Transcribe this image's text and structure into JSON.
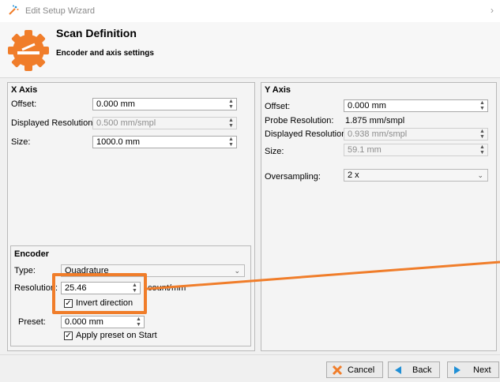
{
  "window": {
    "title": "Edit Setup Wizard"
  },
  "header": {
    "title": "Scan Definition",
    "subtitle": "Encoder and axis settings"
  },
  "x_axis": {
    "title": "X Axis",
    "offset_label": "Offset:",
    "offset_value": "0.000 mm",
    "res_label": "Displayed Resolution:",
    "res_value": "0.500 mm/smpl",
    "size_label": "Size:",
    "size_value": "1000.0 mm"
  },
  "encoder": {
    "title": "Encoder",
    "type_label": "Type:",
    "type_value": "Quadrature",
    "res_label": "Resolution:",
    "res_value": "25.46",
    "res_unit": "count/mm",
    "invert_label": "Invert direction",
    "invert_checked": true,
    "preset_label": "Preset:",
    "preset_value": "0.000 mm",
    "apply_label": "Apply preset on Start",
    "apply_checked": true
  },
  "y_axis": {
    "title": "Y Axis",
    "offset_label": "Offset:",
    "offset_value": "0.000 mm",
    "probe_label": "Probe Resolution:",
    "probe_value": "1.875 mm/smpl",
    "res_label": "Displayed Resolution:",
    "res_value": "0.938 mm/smpl",
    "size_label": "Size:",
    "size_value": "59.1 mm",
    "oversampling_label": "Oversampling:",
    "oversampling_value": "2 x"
  },
  "footer": {
    "cancel": "Cancel",
    "back": "Back",
    "next": "Next"
  },
  "colors": {
    "accent": "#f07d2a",
    "arrow": "#1f8fd6",
    "cancel_icon": "#f07d2a"
  }
}
